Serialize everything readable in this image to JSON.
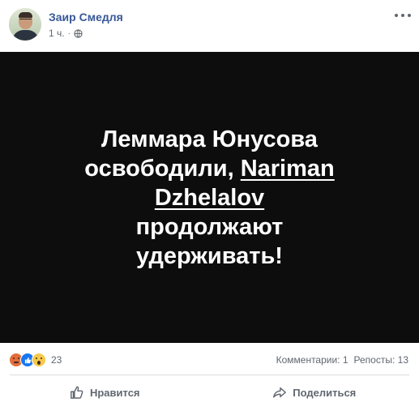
{
  "post": {
    "author_name": "Заир Смедля",
    "timestamp": "1 ч.",
    "separator": "·",
    "audience_icon": "globe-icon",
    "more_icon": "more-options-icon"
  },
  "image_text": {
    "line1": "Леммара Юнусова",
    "line2_prefix": "освободили, ",
    "link_first": "Nariman",
    "link_second": "Dzhelalov",
    "line3_suffix": " продолжают",
    "line4": "удерживать!"
  },
  "stats": {
    "reactions": [
      "angry-reaction-icon",
      "like-reaction-icon",
      "wow-reaction-icon"
    ],
    "reaction_count": "23",
    "comments": "Комментарии: 1",
    "shares": "Репосты: 13"
  },
  "actions": {
    "like_label": "Нравится",
    "share_label": "Поделиться"
  },
  "colors": {
    "author": "#385898",
    "image_bg": "#0d0d0d",
    "secondary_text": "#606770",
    "like_blue": "#1877f2"
  }
}
